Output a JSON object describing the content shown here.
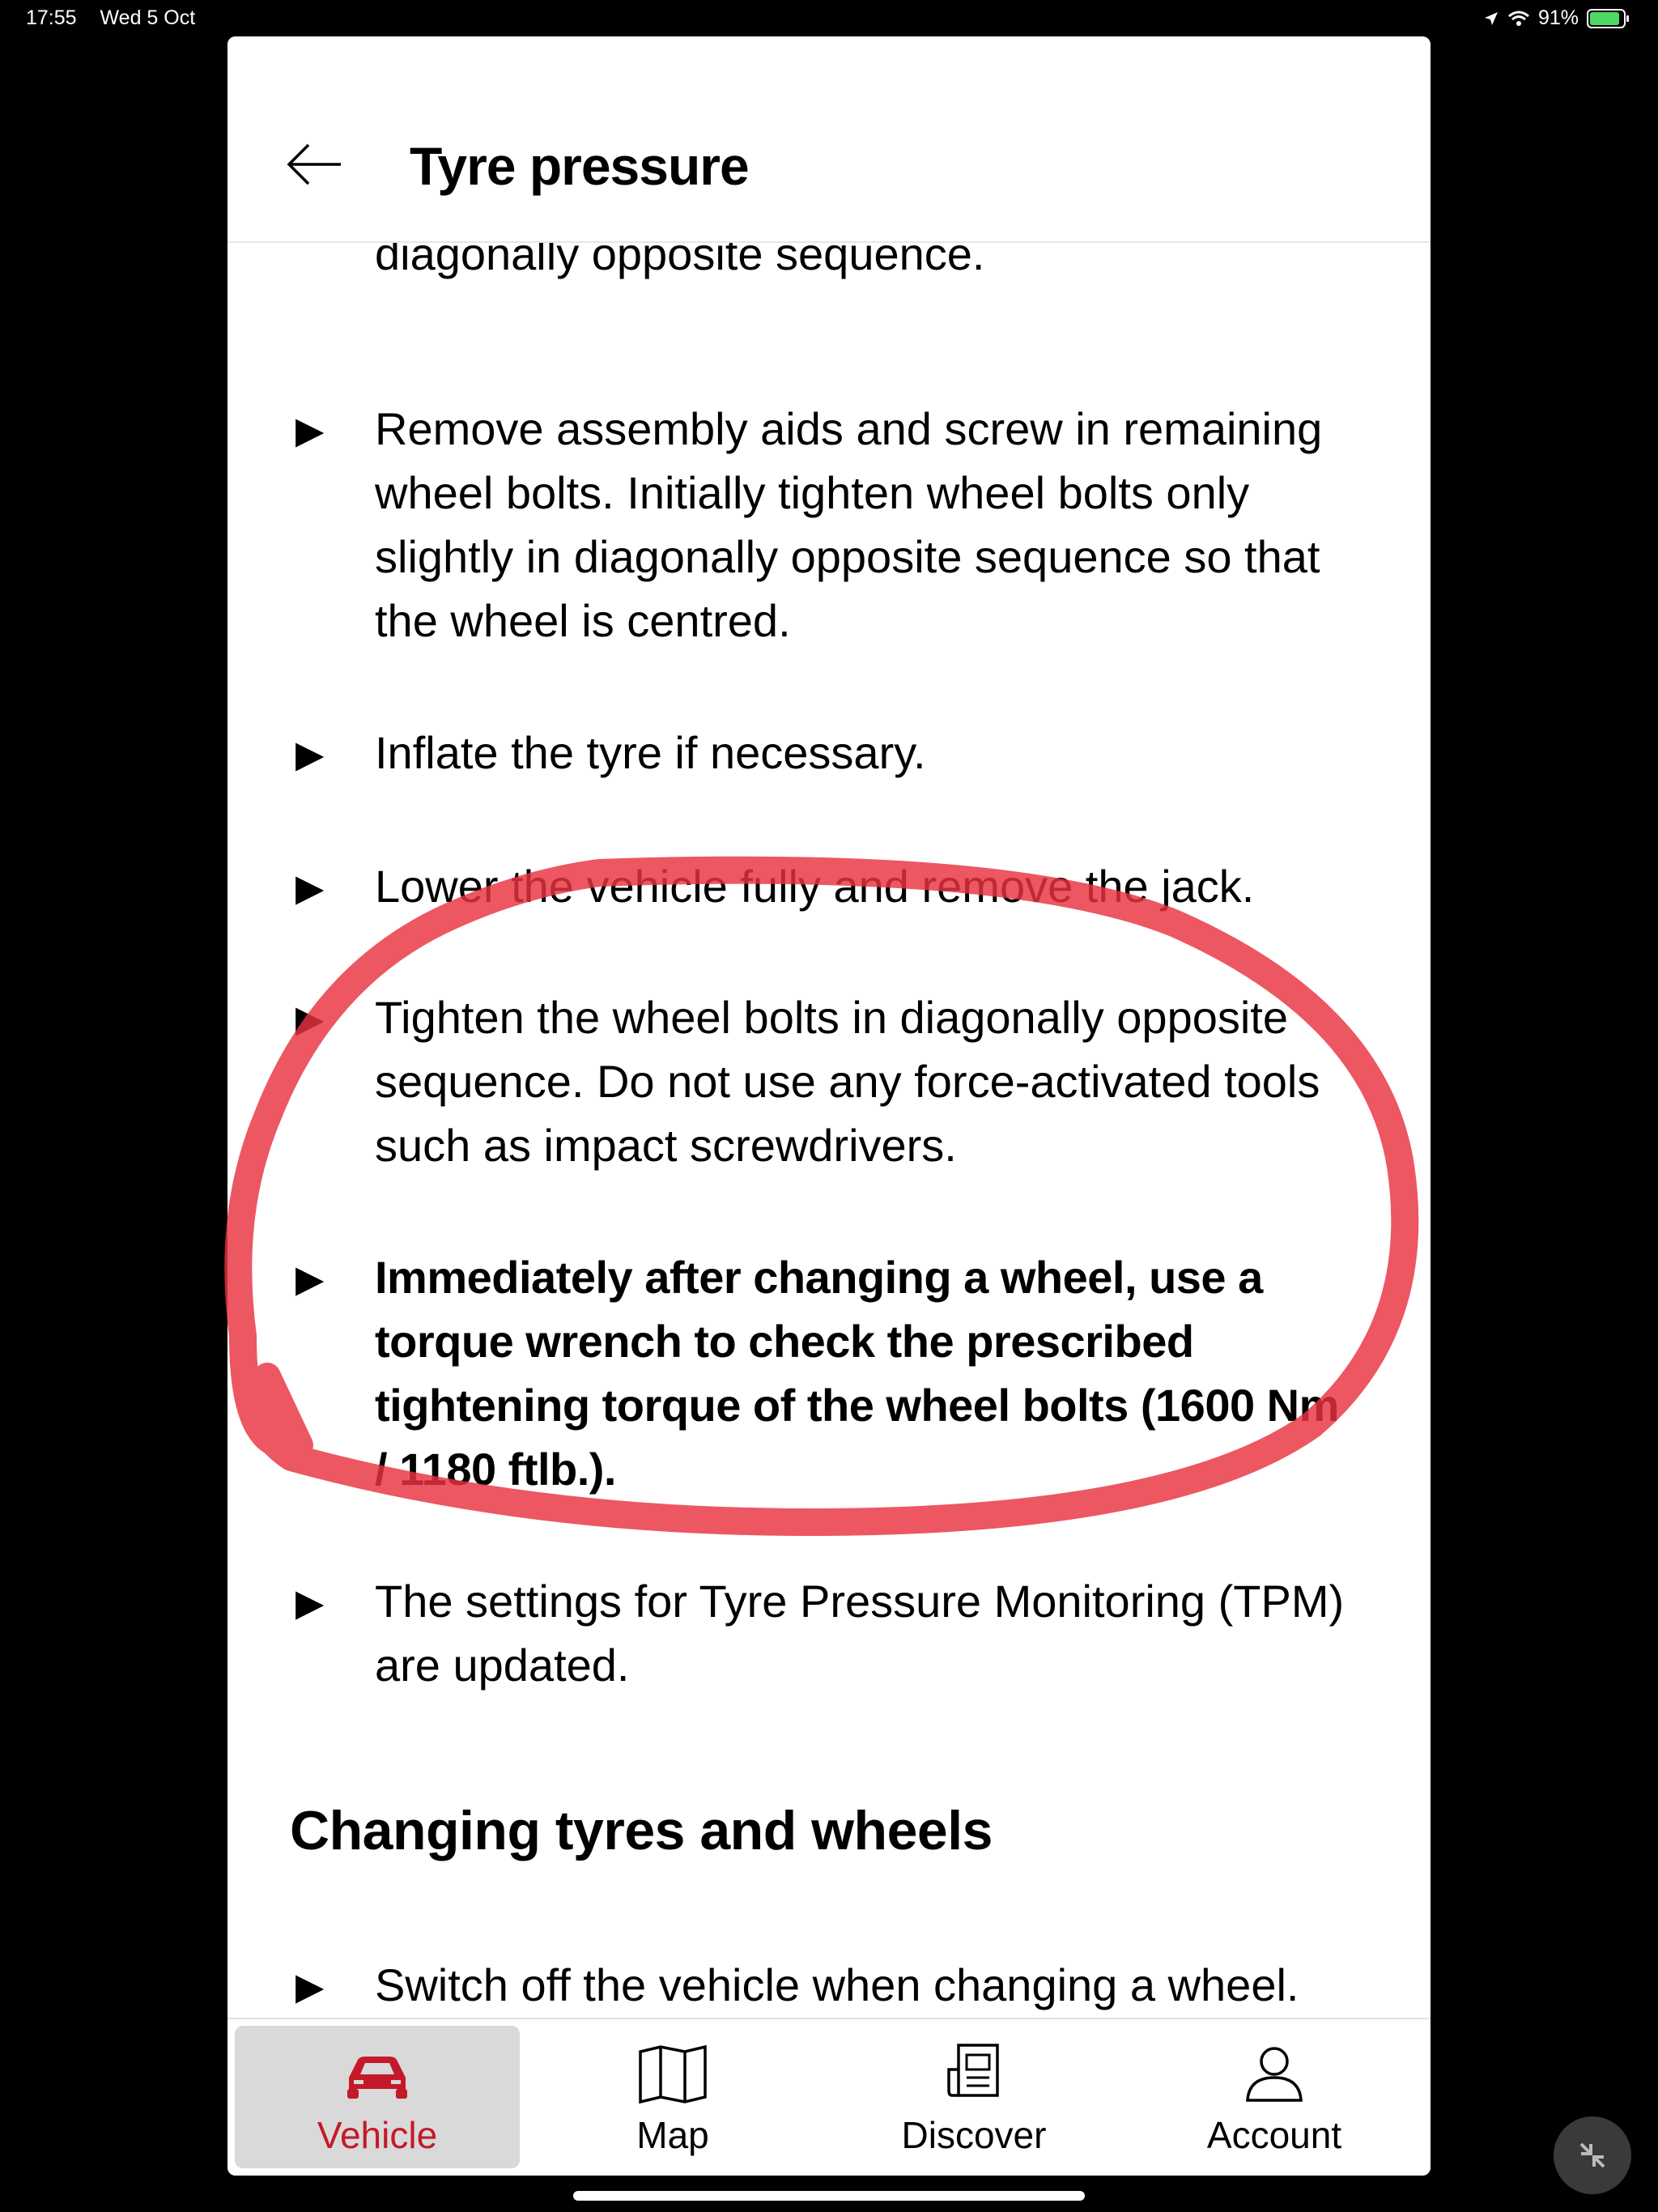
{
  "status_bar": {
    "time": "17:55",
    "date": "Wed 5 Oct",
    "battery": "91%",
    "battery_level": 0.91
  },
  "header": {
    "title": "Tyre pressure"
  },
  "content": {
    "cut_off_text": "diagonally opposite sequence.",
    "steps": [
      {
        "text": "Remove assembly aids and screw in remaining wheel bolts. Initially tighten wheel bolts only slightly in diagonally opposite sequence so that the wheel is centred."
      },
      {
        "text": "Inflate the tyre if necessary."
      },
      {
        "text": "Lower the vehicle fully and remove the jack."
      },
      {
        "text": "Tighten the wheel bolts in diagonally opposite sequence. Do not use any force-activated tools such as impact screwdrivers."
      },
      {
        "text": "Immediately after changing a wheel, use a torque wrench to check the prescribed tightening torque of the wheel bolts (1600 Nm / 1180 ftlb.)."
      },
      {
        "text": "The settings for Tyre Pressure Monitoring (TPM) are updated."
      }
    ],
    "section_heading": "Changing tyres and wheels",
    "section_steps": [
      {
        "text": "Switch off the vehicle when changing a wheel."
      }
    ]
  },
  "tabbar": {
    "tabs": [
      {
        "label": "Vehicle",
        "icon": "car-icon",
        "active": true
      },
      {
        "label": "Map",
        "icon": "map-icon",
        "active": false
      },
      {
        "label": "Discover",
        "icon": "news-icon",
        "active": false
      },
      {
        "label": "Account",
        "icon": "user-icon",
        "active": false
      }
    ]
  },
  "colors": {
    "accent": "#c4192a",
    "annotation": "#e8323f",
    "active_tab_bg": "#d9d9d9"
  },
  "annotation": {
    "shape": "hand-drawn-circle"
  }
}
